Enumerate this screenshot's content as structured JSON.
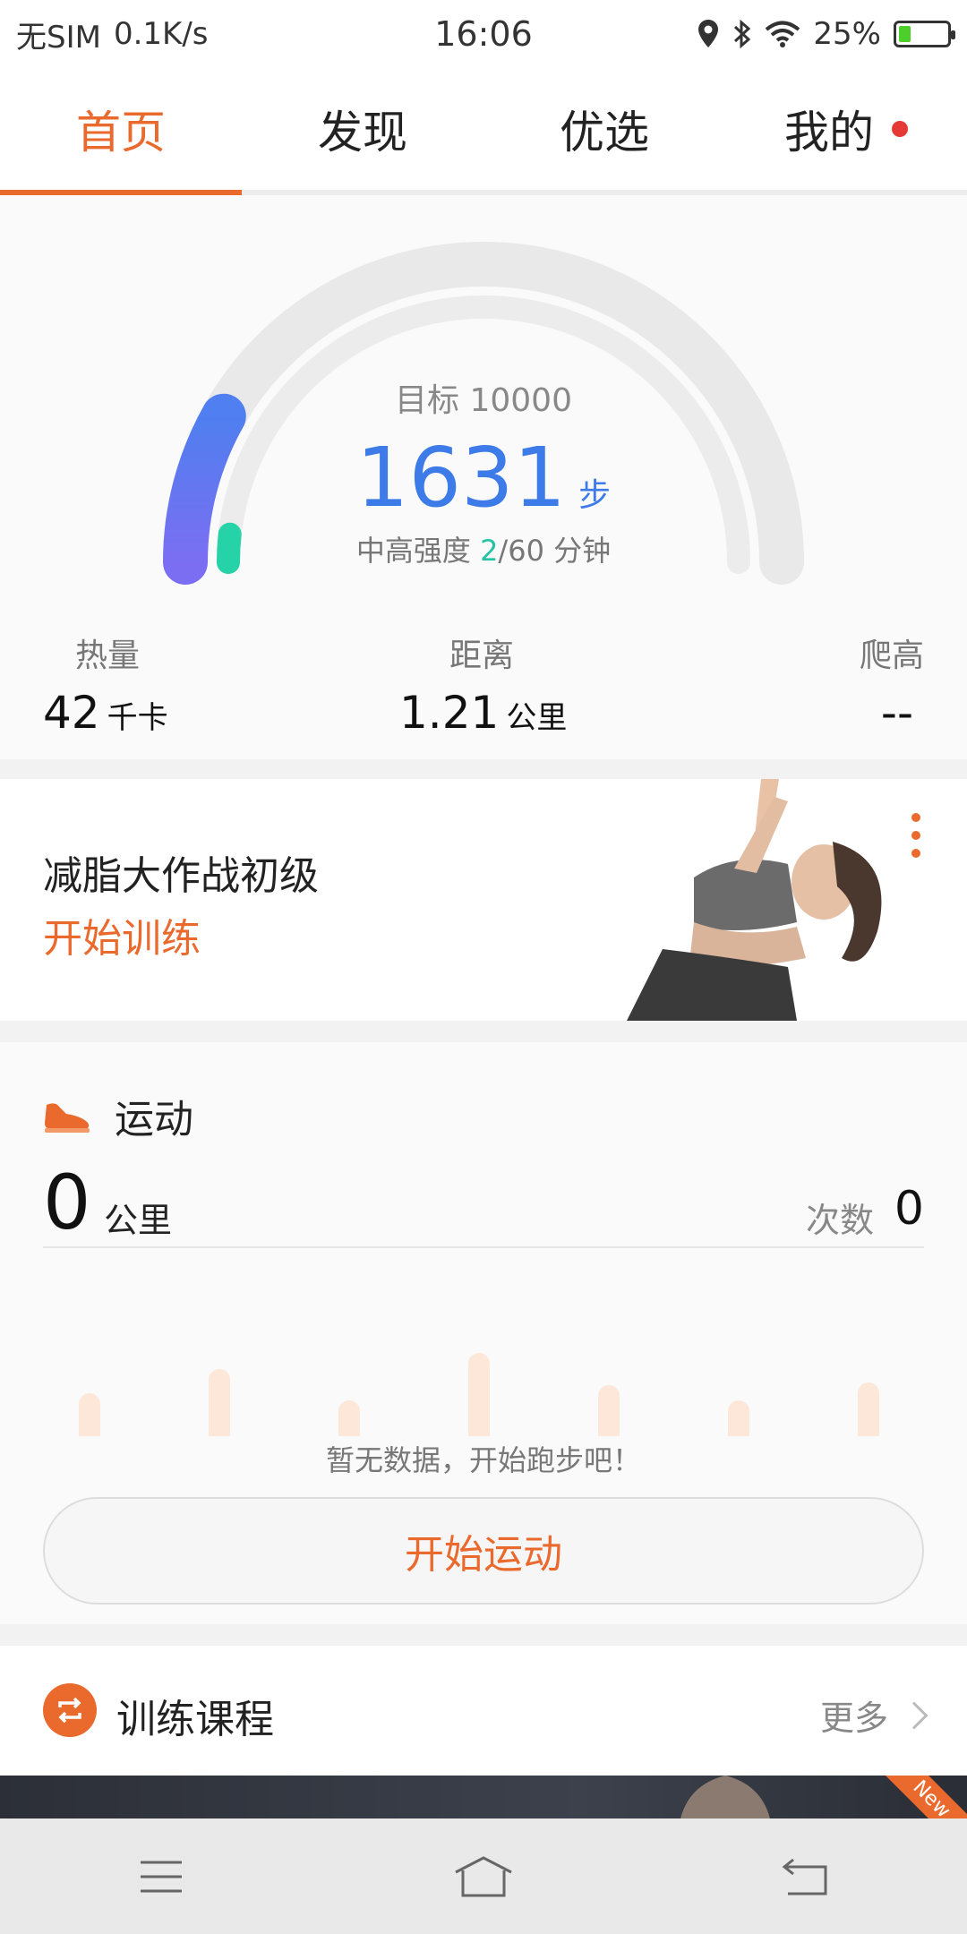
{
  "status_bar": {
    "carrier": "无SIM",
    "speed": "0.1K/s",
    "time": "16:06",
    "battery": "25%",
    "battery_level": 0.25,
    "icons": [
      "location-icon",
      "bluetooth-icon",
      "wifi-icon",
      "battery-icon"
    ]
  },
  "tabs": [
    {
      "label": "首页",
      "active": true
    },
    {
      "label": "发现",
      "active": false
    },
    {
      "label": "优选",
      "active": false
    },
    {
      "label": "我的",
      "active": false,
      "badge": true
    }
  ],
  "summary": {
    "goal": "目标 10000",
    "steps": "1631",
    "steps_unit": "步",
    "intensity_prefix": "中高强度 ",
    "intensity_value": "2",
    "intensity_suffix": "/60 分钟",
    "steps_progress": 0.1631
  },
  "metrics": {
    "calories": {
      "label": "热量",
      "value": "42",
      "unit": "千卡"
    },
    "distance": {
      "label": "距离",
      "value": "1.21",
      "unit": "公里"
    },
    "climb": {
      "label": "爬高",
      "value": "--"
    }
  },
  "training": {
    "title": "减脂大作战初级",
    "action": "开始训练"
  },
  "sport": {
    "title": "运动",
    "distance_value": "0",
    "distance_unit": "公里",
    "count_label": "次数",
    "count_value": "0",
    "empty_text": "暂无数据，开始跑步吧！",
    "start_button": "开始运动",
    "placeholder_bars": [
      0.32,
      0.5,
      0.27,
      0.62,
      0.38,
      0.27,
      0.4
    ]
  },
  "courses": {
    "title": "训练课程",
    "more": "更多",
    "banner_tag": "New"
  },
  "colors": {
    "accent": "#ea6a2d",
    "steps_blue": "#3d7be8",
    "intensity_green": "#26c3a3"
  }
}
